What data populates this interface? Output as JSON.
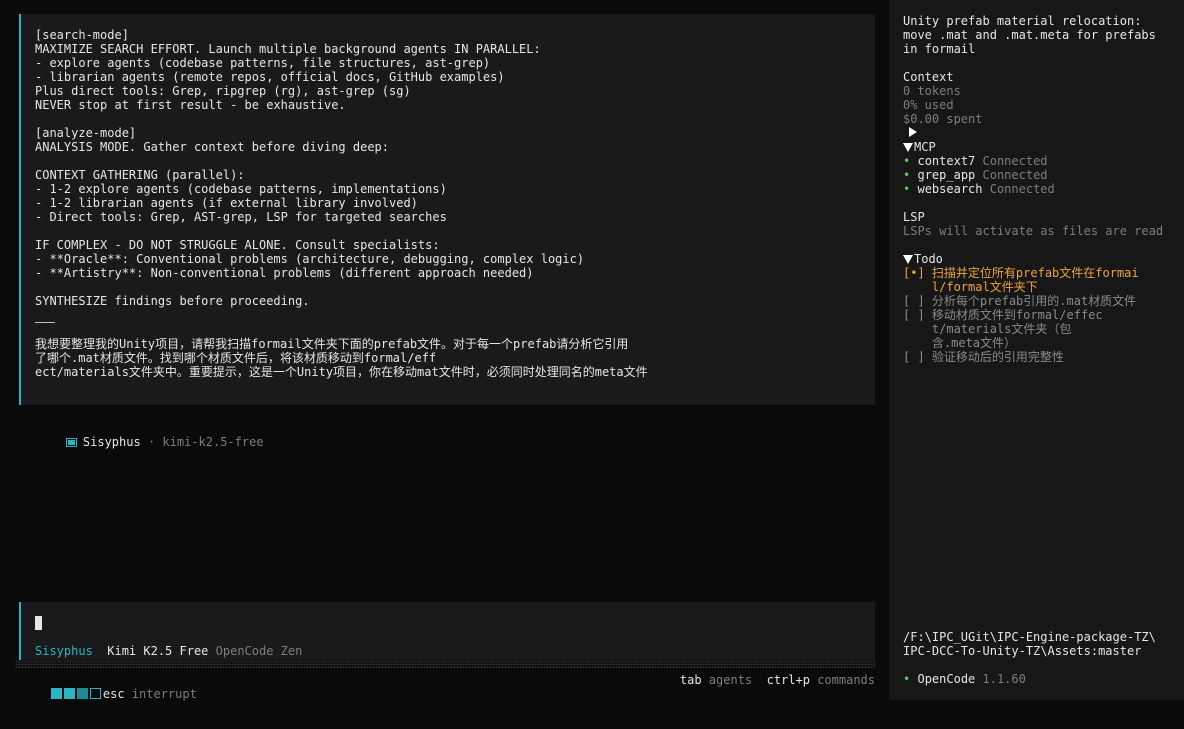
{
  "message": {
    "lines": [
      "[search-mode]",
      "MAXIMIZE SEARCH EFFORT. Launch multiple background agents IN PARALLEL:",
      "- explore agents (codebase patterns, file structures, ast-grep)",
      "- librarian agents (remote repos, official docs, GitHub examples)",
      "Plus direct tools: Grep, ripgrep (rg), ast-grep (sg)",
      "NEVER stop at first result - be exhaustive.",
      "",
      "[analyze-mode]",
      "ANALYSIS MODE. Gather context before diving deep:",
      "",
      "CONTEXT GATHERING (parallel):",
      "- 1-2 explore agents (codebase patterns, implementations)",
      "- 1-2 librarian agents (if external library involved)",
      "- Direct tools: Grep, AST-grep, LSP for targeted searches",
      "",
      "IF COMPLEX - DO NOT STRUGGLE ALONE. Consult specialists:",
      "- **Oracle**: Conventional problems (architecture, debugging, complex logic)",
      "- **Artistry**: Non-conventional problems (different approach needed)",
      "",
      "SYNTHESIZE findings before proceeding."
    ],
    "user_lines": [
      "我想要整理我的Unity项目，请帮我扫描formail文件夹下面的prefab文件。对于每一个prefab请分析它引用",
      "了哪个.mat材质文件。找到哪个材质文件后，将该材质移动到formal/eff",
      "ect/materials文件夹中。重要提示，这是一个Unity项目，你在移动mat文件时，必须同时处理同名的meta文件"
    ]
  },
  "agent": {
    "name": "Sisyphus",
    "sep": "·",
    "model": "kimi-k2.5-free"
  },
  "input": {
    "agent": "Sisyphus",
    "model": "Kimi K2.5 Free",
    "provider": "OpenCode Zen"
  },
  "bottom": {
    "esc_key": "esc",
    "esc_action": "interrupt",
    "tab_key": "tab",
    "tab_action": "agents",
    "cmd_key": "ctrl+p",
    "cmd_action": "commands"
  },
  "sidebar": {
    "title_lines": [
      "Unity prefab material relocation:",
      "move .mat and .mat.meta for prefabs",
      "in formail"
    ],
    "context": {
      "heading": "Context",
      "tokens": "0 tokens",
      "used": "0% used",
      "spent": "$0.00 spent"
    },
    "mcp": {
      "heading": "MCP",
      "items": [
        {
          "name": "context7",
          "status": "Connected"
        },
        {
          "name": "grep_app",
          "status": "Connected"
        },
        {
          "name": "websearch",
          "status": "Connected"
        }
      ]
    },
    "lsp": {
      "heading": "LSP",
      "text": "LSPs will activate as files are read"
    },
    "todo": {
      "heading": "Todo",
      "items": [
        {
          "mark": "[•]",
          "lines": [
            "扫描并定位所有prefab文件在formai",
            "l/formal文件夹下"
          ],
          "active": true
        },
        {
          "mark": "[ ]",
          "lines": [
            "分析每个prefab引用的.mat材质文件"
          ],
          "active": false
        },
        {
          "mark": "[ ]",
          "lines": [
            "移动材质文件到formal/effec",
            "t/materials文件夹（包",
            "含.meta文件）"
          ],
          "active": false
        },
        {
          "mark": "[ ]",
          "lines": [
            "验证移动后的引用完整性"
          ],
          "active": false
        }
      ]
    },
    "path_lines": [
      "/F:\\IPC_UGit\\IPC-Engine-package-TZ\\",
      "IPC-DCC-To-Unity-TZ\\Assets:master"
    ],
    "version": {
      "bullet": "•",
      "app": "OpenCode",
      "ver": "1.1.60"
    }
  },
  "colors": {
    "accent": "#2bb5c4",
    "connected": "#5cc85c",
    "todo_active": "#f0a33a"
  }
}
